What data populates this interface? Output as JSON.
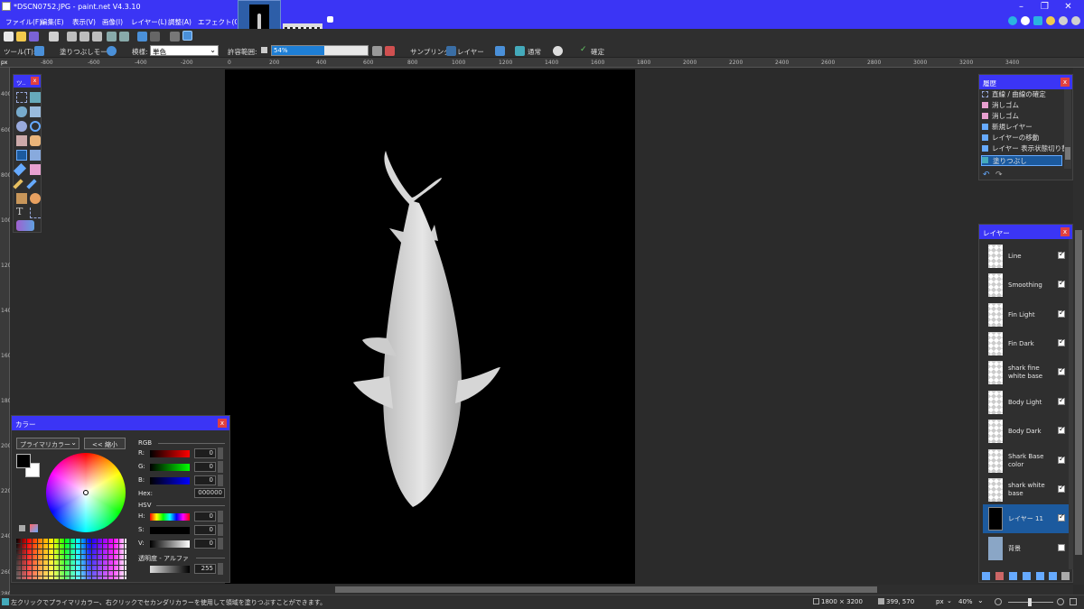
{
  "window": {
    "title": "*DSCN0752.JPG - paint.net V4.3.10"
  },
  "menu": [
    "ファイル(F)",
    "編集(E)",
    "表示(V)",
    "画像(I)",
    "レイヤー(L)",
    "調整(A)",
    "エフェクト(C)"
  ],
  "toolbar": {
    "tool_label": "ツール(T):",
    "fill_mode_label": "塗りつぶしモード:",
    "mode_label": "模様:",
    "mode_value": "単色",
    "tolerance_label": "許容範囲:",
    "tolerance_value": "54%",
    "sampling_label": "サンプリング:",
    "sampling_value": "レイヤー",
    "blend_value": "通常",
    "finish_label": "確定"
  },
  "ruler": {
    "unit": "px",
    "top_ticks": [
      "-800",
      "-600",
      "-400",
      "-200",
      "0",
      "200",
      "400",
      "600",
      "800",
      "1000",
      "1200",
      "1400",
      "1600",
      "1800",
      "2000",
      "2200",
      "2400",
      "2600",
      "2800",
      "3000",
      "3200",
      "3400"
    ],
    "left_ticks": [
      "400",
      "600",
      "800",
      "1000",
      "1200",
      "1400",
      "1600",
      "1800",
      "2000",
      "2200",
      "2400",
      "2600",
      "2800"
    ]
  },
  "tools_panel": {
    "title": "ツ.."
  },
  "history_panel": {
    "title": "履歴",
    "items": [
      "直線 / 曲線の確定",
      "消しゴム",
      "消しゴム",
      "新規レイヤー",
      "レイヤーの移動",
      "レイヤー 表示状態切り替え",
      "塗りつぶし"
    ],
    "selected_index": 6
  },
  "layers_panel": {
    "title": "レイヤー",
    "layers": [
      {
        "name": "Line",
        "visible": true
      },
      {
        "name": "Smoothing",
        "visible": true
      },
      {
        "name": "Fin Light",
        "visible": true
      },
      {
        "name": "Fin Dark",
        "visible": true
      },
      {
        "name": "shark fine white base",
        "visible": true
      },
      {
        "name": "Body Light",
        "visible": true
      },
      {
        "name": "Body Dark",
        "visible": true
      },
      {
        "name": "Shark Base color",
        "visible": true
      },
      {
        "name": "shark white base",
        "visible": true
      },
      {
        "name": "レイヤー 11",
        "visible": true
      },
      {
        "name": "背景",
        "visible": false
      }
    ],
    "selected_index": 9
  },
  "color_panel": {
    "title": "カラー",
    "primary_select": "プライマリカラー",
    "shrink_button": "<< 縮小",
    "rgb_label": "RGB",
    "r_label": "R:",
    "r_value": "0",
    "g_label": "G:",
    "g_value": "0",
    "b_label": "B:",
    "b_value": "0",
    "hex_label": "Hex:",
    "hex_value": "000000",
    "hsv_label": "HSV",
    "h_label": "H:",
    "h_value": "0",
    "s_label": "S:",
    "s_value": "0",
    "v_label": "V:",
    "v_value": "0",
    "alpha_label": "透明度 - アルファ",
    "alpha_value": "255"
  },
  "status": {
    "hint": "左クリックでプライマリカラー、右クリックでセカンダリカラーを使用して領域を塗りつぶすことができます。",
    "image_size": "1800 × 3200",
    "cursor": "399, 570",
    "unit": "px",
    "zoom": "40%"
  },
  "colors": {
    "accent": "#3b35f5",
    "panel_bg": "#2f2f2f",
    "selected": "#1c5a9e",
    "close": "#e04040"
  }
}
